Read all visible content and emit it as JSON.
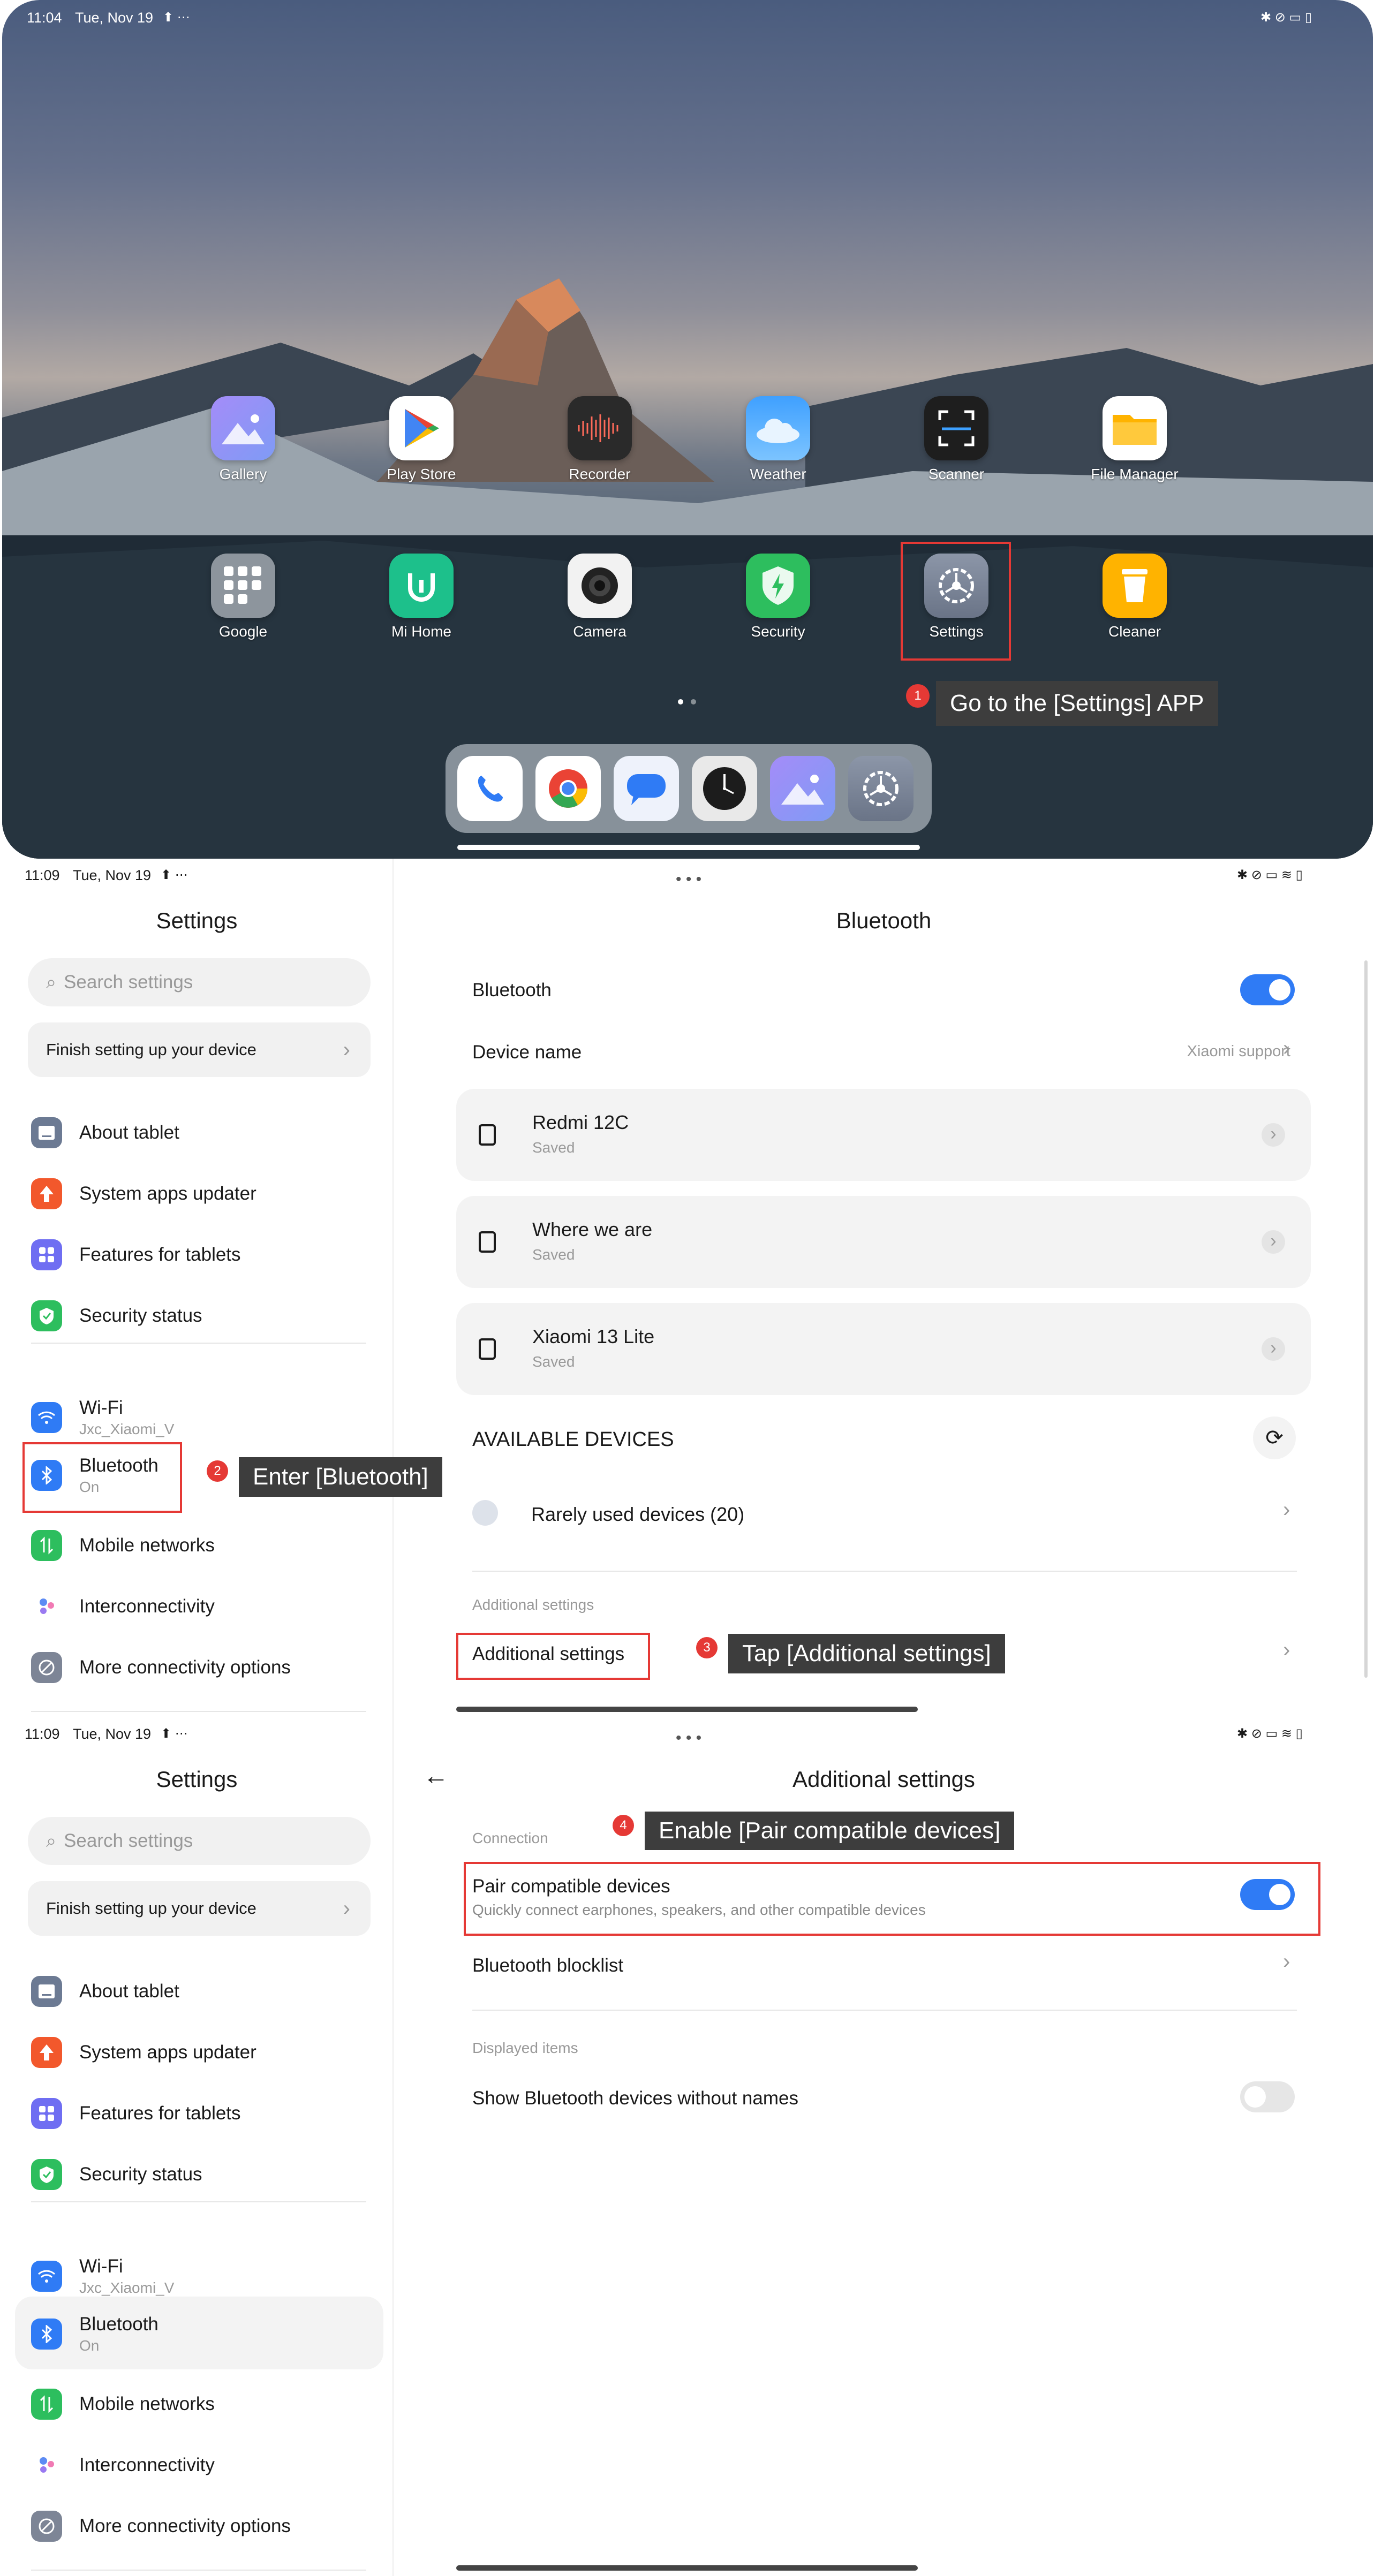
{
  "home": {
    "status": {
      "time": "11:04",
      "date": "Tue, Nov 19"
    },
    "apps_row1": [
      {
        "label": "Gallery",
        "icon": "gallery-icon"
      },
      {
        "label": "Play Store",
        "icon": "play-store-icon"
      },
      {
        "label": "Recorder",
        "icon": "recorder-icon"
      },
      {
        "label": "Weather",
        "icon": "weather-icon"
      },
      {
        "label": "Scanner",
        "icon": "scanner-icon"
      },
      {
        "label": "File Manager",
        "icon": "folder-icon"
      }
    ],
    "apps_row2": [
      {
        "label": "Google",
        "icon": "google-folder-icon"
      },
      {
        "label": "Mi Home",
        "icon": "mi-home-icon"
      },
      {
        "label": "Camera",
        "icon": "camera-icon"
      },
      {
        "label": "Security",
        "icon": "security-icon"
      },
      {
        "label": "Settings",
        "icon": "settings-icon"
      },
      {
        "label": "Cleaner",
        "icon": "cleaner-icon"
      }
    ],
    "dock": [
      "phone-icon",
      "chrome-icon",
      "messages-icon",
      "clock-icon",
      "gallery-icon",
      "settings-icon"
    ]
  },
  "steps": [
    {
      "num": "1",
      "text": "Go to the [Settings] APP"
    },
    {
      "num": "2",
      "text": "Enter [Bluetooth]"
    },
    {
      "num": "3",
      "text": "Tap [Additional settings]"
    },
    {
      "num": "4",
      "text": "Enable [Pair compatible devices]"
    }
  ],
  "settings": {
    "status": {
      "time": "11:09",
      "date": "Tue, Nov 19"
    },
    "title": "Settings",
    "search_placeholder": "Search settings",
    "finish": "Finish setting up your device",
    "menu": [
      {
        "label": "About tablet",
        "sub": "",
        "icon": "tablet-icon",
        "color": "#6c7a93"
      },
      {
        "label": "System apps updater",
        "sub": "",
        "icon": "arrow-up-icon",
        "color": "#f2582c"
      },
      {
        "label": "Features for tablets",
        "sub": "",
        "icon": "grid-icon",
        "color": "#6f6ef2"
      },
      {
        "label": "Security status",
        "sub": "",
        "icon": "shield-check-icon",
        "color": "#2dbe5e"
      },
      {
        "label": "Wi-Fi",
        "sub": "Jxc_Xiaomi_V",
        "icon": "wifi-icon",
        "color": "#2f7bf5"
      },
      {
        "label": "Bluetooth",
        "sub": "On",
        "icon": "bluetooth-icon",
        "color": "#2f7bf5"
      },
      {
        "label": "Mobile networks",
        "sub": "",
        "icon": "mobile-data-icon",
        "color": "#2dbe5e"
      },
      {
        "label": "Interconnectivity",
        "sub": "",
        "icon": "interconnectivity-icon",
        "color": "#ffffff"
      },
      {
        "label": "More connectivity options",
        "sub": "",
        "icon": "link-icon",
        "color": "#7d8596"
      }
    ]
  },
  "bluetooth": {
    "title": "Bluetooth",
    "toggle_label": "Bluetooth",
    "toggle_on": true,
    "device_name_label": "Device name",
    "device_name_value": "Xiaomi support",
    "saved_devices": [
      {
        "name": "Redmi 12C",
        "status": "Saved"
      },
      {
        "name": "Where we are",
        "status": "Saved"
      },
      {
        "name": "Xiaomi 13 Lite",
        "status": "Saved"
      }
    ],
    "available_header": "AVAILABLE DEVICES",
    "rarely_used": "Rarely used devices (20)",
    "additional_header": "Additional settings",
    "additional_item": "Additional settings"
  },
  "additional": {
    "title": "Additional settings",
    "connection_header": "Connection",
    "pair_title": "Pair compatible devices",
    "pair_sub": "Quickly connect earphones, speakers, and other compatible devices",
    "pair_on": true,
    "blocklist": "Bluetooth blocklist",
    "displayed_header": "Displayed items",
    "show_unnamed": "Show Bluetooth devices without names",
    "show_unnamed_on": false
  }
}
